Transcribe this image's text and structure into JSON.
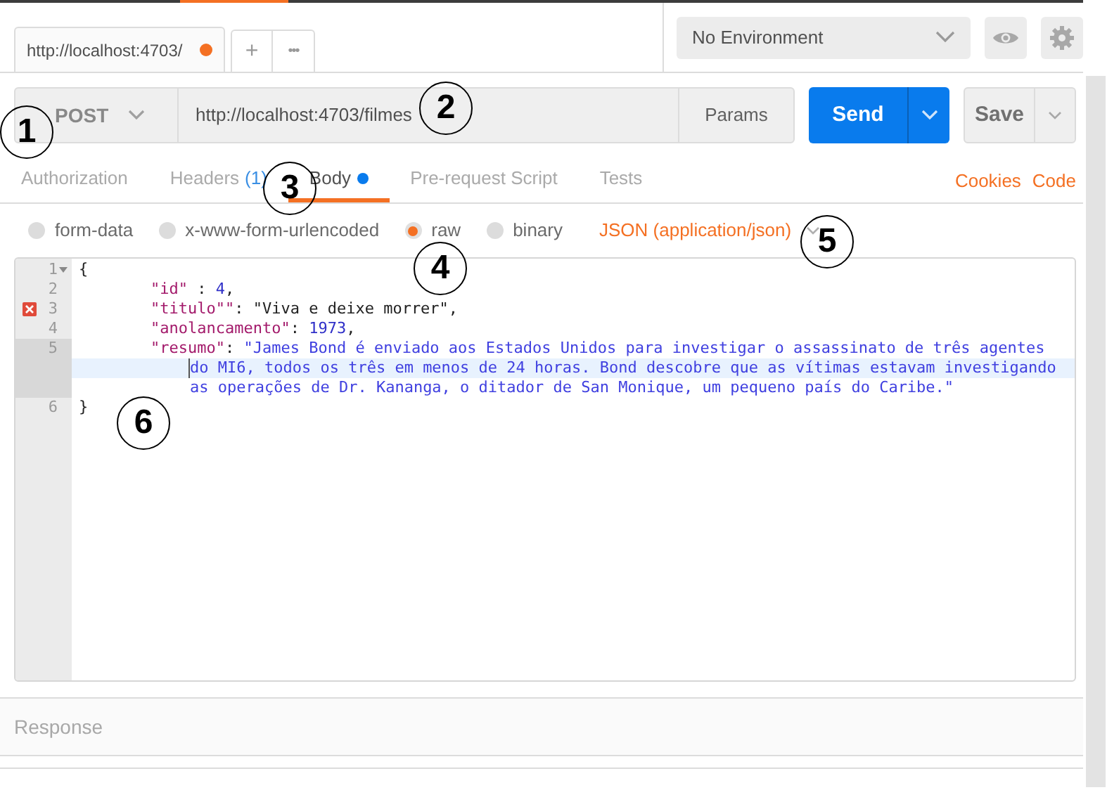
{
  "request_tabs": [
    {
      "label": "http://localhost:4703/",
      "unsaved": true,
      "selected": true
    }
  ],
  "tab_actions": {
    "new_tab": "+",
    "more": "•••"
  },
  "environment": {
    "value": "No Environment"
  },
  "request": {
    "method": "POST",
    "url": "http://localhost:4703/filmes",
    "params_button": "Params",
    "send_button": "Send",
    "save_button": "Save"
  },
  "sections": [
    {
      "label": "Authorization",
      "selected": false
    },
    {
      "label": "Headers",
      "count": "(1)",
      "selected": false
    },
    {
      "label": "Body",
      "has_content": true,
      "selected": true
    },
    {
      "label": "Pre-request Script",
      "selected": false
    },
    {
      "label": "Tests",
      "selected": false
    }
  ],
  "links": [
    "Cookies",
    "Code"
  ],
  "body_modes": [
    {
      "label": "form-data",
      "selected": false
    },
    {
      "label": "x-www-form-urlencoded",
      "selected": false
    },
    {
      "label": "raw",
      "selected": true
    },
    {
      "label": "binary",
      "selected": false
    }
  ],
  "content_type": "JSON (application/json)",
  "editor_lines": [
    {
      "number": "1",
      "fold": true,
      "error": false,
      "active": false,
      "rows": [
        {
          "cursor": false,
          "tokens": [
            {
              "kind": "punct",
              "text": "{"
            }
          ]
        }
      ]
    },
    {
      "number": "2",
      "fold": false,
      "error": false,
      "active": false,
      "rows": [
        {
          "cursor": false,
          "tokens": [
            {
              "kind": "key",
              "text": "\"id\""
            },
            {
              "kind": "punct",
              "text": " : "
            },
            {
              "kind": "number",
              "text": "4"
            },
            {
              "kind": "punct",
              "text": ","
            }
          ]
        }
      ]
    },
    {
      "number": "3",
      "fold": false,
      "error": true,
      "active": false,
      "rows": [
        {
          "cursor": false,
          "tokens": [
            {
              "kind": "key",
              "text": "\"titulo\"\""
            },
            {
              "kind": "punct",
              "text": ": \"Viva e deixe morrer\","
            }
          ]
        }
      ]
    },
    {
      "number": "4",
      "fold": false,
      "error": false,
      "active": false,
      "rows": [
        {
          "cursor": false,
          "tokens": [
            {
              "kind": "key",
              "text": "\"anolancamento\""
            },
            {
              "kind": "punct",
              "text": ": "
            },
            {
              "kind": "number",
              "text": "1973"
            },
            {
              "kind": "punct",
              "text": ","
            }
          ]
        }
      ]
    },
    {
      "number": "5",
      "fold": false,
      "error": false,
      "active": true,
      "rows": [
        {
          "cursor": false,
          "tokens": [
            {
              "kind": "key",
              "text": "\"resumo\""
            },
            {
              "kind": "punct",
              "text": ": "
            },
            {
              "kind": "string",
              "text": "\"James Bond é enviado aos Estados Unidos para investigar o assassinato de três agentes"
            }
          ]
        },
        {
          "cursor": true,
          "tokens": [
            {
              "kind": "string",
              "text": "do MI6, todos os três em menos de 24 horas. Bond descobre que as vítimas estavam investigando"
            }
          ]
        },
        {
          "cursor": false,
          "tokens": [
            {
              "kind": "string",
              "text": "as operações de Dr. Kananga, o ditador de San Monique, um pequeno país do Caribe.\""
            }
          ]
        }
      ]
    },
    {
      "number": "6",
      "fold": false,
      "error": false,
      "active": false,
      "rows": [
        {
          "cursor": false,
          "tokens": [
            {
              "kind": "punct",
              "text": "}"
            }
          ]
        }
      ]
    }
  ],
  "response": {
    "label": "Response"
  },
  "annotations": [
    "1",
    "2",
    "3",
    "4",
    "5",
    "6"
  ]
}
